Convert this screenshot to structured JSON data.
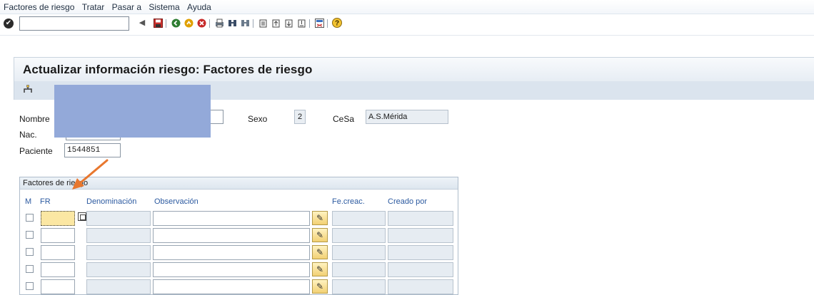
{
  "menubar": {
    "items": [
      "Factores de riesgo",
      "Tratar",
      "Pasar a",
      "Sistema",
      "Ayuda"
    ]
  },
  "toolbar": {
    "ok_icon": "check-circle-icon",
    "command_field_value": "",
    "icons": [
      "back-triangle-icon",
      "save-icon",
      "back-icon",
      "exit-icon",
      "cancel-icon",
      "print-icon",
      "find-icon",
      "find-next-icon",
      "first-page-icon",
      "previous-page-icon",
      "next-page-icon",
      "last-page-icon",
      "new-session-icon",
      "help-icon"
    ]
  },
  "title": "Actualizar información riesgo: Factores de riesgo",
  "app_toolbar": {
    "icon": "hierarchy-icon"
  },
  "header": {
    "nombre_label": "Nombre",
    "sexo_label": "Sexo",
    "sexo_value": "2",
    "cesa_label": "CeSa",
    "cesa_value": "A.S.Mérida",
    "nac_label": "Nac.",
    "paciente_label": "Paciente",
    "paciente_value": "1544851"
  },
  "table": {
    "title": "Factores de riesgo",
    "columns": {
      "m": "M",
      "fr": "FR",
      "denominacion": "Denominación",
      "observacion": "Observación",
      "fecreac": "Fe.creac.",
      "creadopor": "Creado por"
    },
    "row_count": 5
  },
  "colors": {
    "redaction": "#93a9d9",
    "arrow": "#e8772e",
    "header_text": "#2c5aa0"
  }
}
